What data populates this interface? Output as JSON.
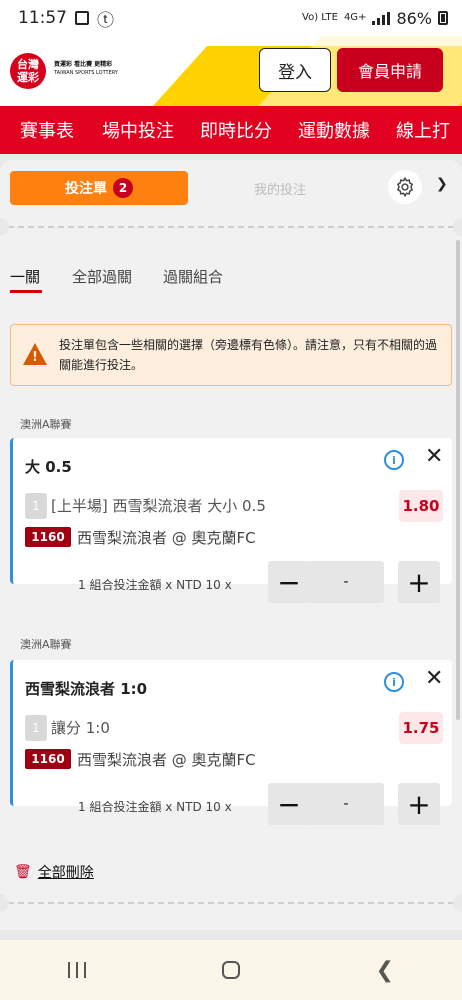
{
  "status": {
    "time": "11:57",
    "net1": "Vo) LTE",
    "net2": "4G+",
    "battery": "86%"
  },
  "header": {
    "logo_text_line1": "台灣",
    "logo_text_line2": "運彩",
    "logo_sub": "買運彩 看比賽 更精彩",
    "logo_sub2": "TAIWAN SPORTS LOTTERY",
    "login_label": "登入",
    "register_label": "會員申請"
  },
  "nav": {
    "items": [
      "賽事表",
      "場中投注",
      "即時比分",
      "運動數據",
      "線上打"
    ]
  },
  "betslip": {
    "tab_cart": "投注單",
    "cart_count": "2",
    "tab_mine": "我的投注",
    "subtabs": [
      "一關",
      "全部過關",
      "過關組合"
    ],
    "warning": "投注單包含一些相關的選擇（旁邊標有色條）。請注意，只有不相關的過關能進行投注。",
    "bets": [
      {
        "league": "澳洲A聯賽",
        "title": "大 0.5",
        "num": "1",
        "selection": "[上半場] 西雪梨流浪者 大小 0.5",
        "odds": "1.80",
        "code": "1160",
        "match": "西雪梨流浪者 @ 奧克蘭FC",
        "amount_label": "1 組合投注金額 x NTD 10 x",
        "stake": "-"
      },
      {
        "league": "澳洲A聯賽",
        "title": "西雪梨流浪者 1:0",
        "num": "1",
        "selection": "讓分 1:0",
        "odds": "1.75",
        "code": "1160",
        "match": "西雪梨流浪者 @ 奧克蘭FC",
        "amount_label": "1 組合投注金額 x NTD 10 x",
        "stake": "-"
      }
    ],
    "delete_all": "全部刪除"
  },
  "colors": {
    "brand_red": "#e1001f",
    "accent_orange": "#ff7f0f",
    "info_blue": "#2e8fe0"
  }
}
